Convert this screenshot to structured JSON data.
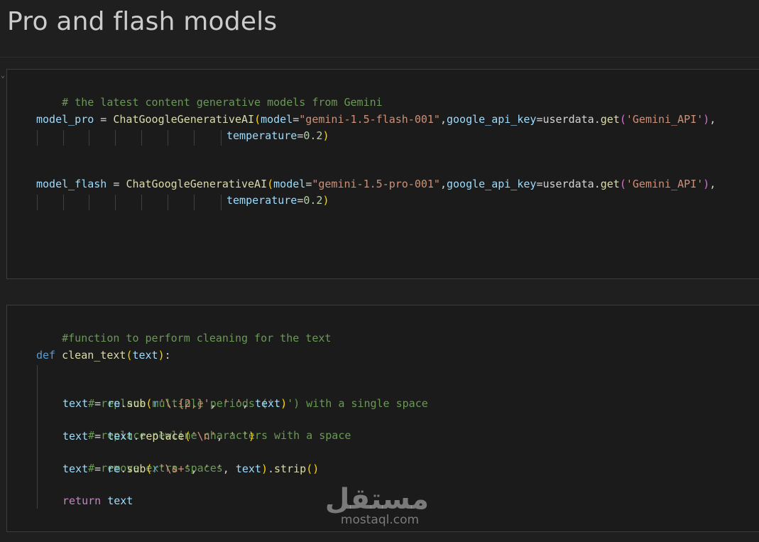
{
  "heading": "Pro and flash models",
  "cell1": {
    "comment": "# the latest content generative models from Gemini",
    "pro": {
      "var": "model_pro",
      "eq": " = ",
      "cls": "ChatGoogleGenerativeAI",
      "open": "(",
      "kw_model": "model",
      "assign": "=",
      "model_value": "\"gemini-1.5-flash-001\"",
      "comma": ",",
      "kw_key": "google_api_key",
      "userdata": "userdata",
      "dot": ".",
      "get": "get",
      "open2": "(",
      "key_value": "'Gemini_API'",
      "close2": ")",
      "comma2": ",",
      "kw_temp": "temperature",
      "temp_value": "0.2",
      "close": ")"
    },
    "flash": {
      "var": "model_flash",
      "eq": " = ",
      "cls": "ChatGoogleGenerativeAI",
      "open": "(",
      "kw_model": "model",
      "assign": "=",
      "model_value": "\"gemini-1.5-pro-001\"",
      "comma": ",",
      "kw_key": "google_api_key",
      "userdata": "userdata",
      "dot": ".",
      "get": "get",
      "open2": "(",
      "key_value": "'Gemini_API'",
      "close2": ")",
      "comma2": ",",
      "kw_temp": "temperature",
      "temp_value": "0.2",
      "close": ")"
    }
  },
  "cell2": {
    "comment": "#function to perform cleaning for the text",
    "def_kw": "def",
    "func_name": "clean_text",
    "param": "text",
    "open": "(",
    "close": ")",
    "colon": ":",
    "c1": "# replace multiple periods ('..') with a single space",
    "c2": "# replace newline characters with a space",
    "c3": "# remove extra spaces",
    "text": "text",
    "eq": " = ",
    "re": "re",
    "dot": ".",
    "sub": "sub",
    "replace": "replace",
    "strip": "strip",
    "r": "r",
    "pat1": "'\\.{2,}'",
    "pat2": "'\\s+'",
    "nl": "'\\n'",
    "space": "' '",
    "sep": ", ",
    "empty_parens": "()",
    "return_kw": "return"
  },
  "watermark": {
    "logo": "مستقل",
    "text": "mostaql.com"
  }
}
